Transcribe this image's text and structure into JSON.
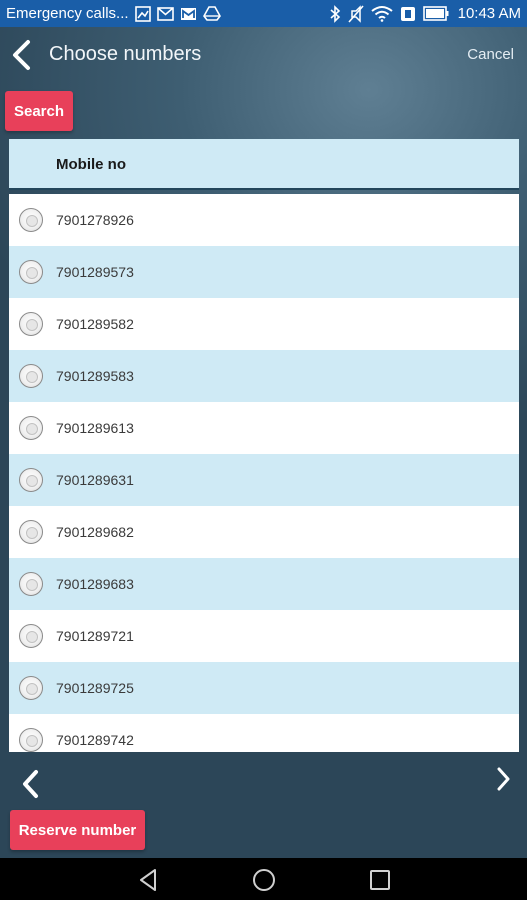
{
  "status_bar": {
    "notification_text": "Emergency calls...",
    "time": "10:43 AM",
    "left_icons": [
      "image-icon",
      "email-icon",
      "gmail-icon",
      "drive-icon"
    ],
    "right_icons": [
      "bluetooth-icon",
      "mute-icon",
      "wifi-icon",
      "nfc-icon",
      "battery-icon"
    ]
  },
  "app_bar": {
    "title": "Choose numbers",
    "cancel_label": "Cancel"
  },
  "search": {
    "label": "Search"
  },
  "table": {
    "header": "Mobile no",
    "rows": [
      "7901278926",
      "7901289573",
      "7901289582",
      "7901289583",
      "7901289613",
      "7901289631",
      "7901289682",
      "7901289683",
      "7901289721",
      "7901289725",
      "7901289742"
    ]
  },
  "footer": {
    "reserve_label": "Reserve number"
  },
  "colors": {
    "status_bar": "#1a5ea8",
    "accent": "#e8405a",
    "row_stripe": "#cfeaf5",
    "header_border": "#23465b"
  }
}
